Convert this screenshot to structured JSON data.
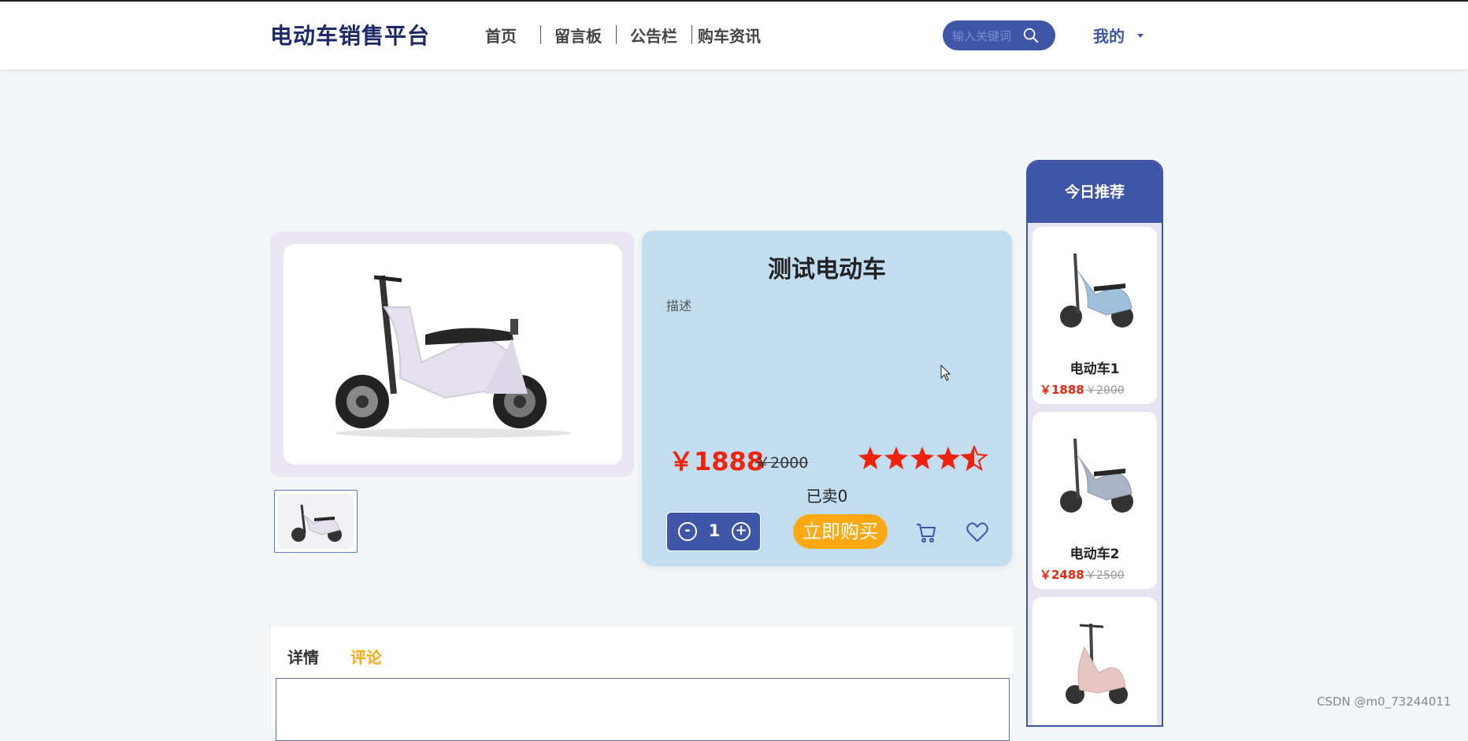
{
  "header": {
    "logo": "电动车销售平台",
    "nav": [
      "首页",
      "留言板",
      "公告栏",
      "购车资讯"
    ],
    "search_placeholder": "输入关键词",
    "user_menu": "我的"
  },
  "product": {
    "title": "测试电动车",
    "description": "描述",
    "price": "￥1888",
    "original_price": "￥2000",
    "rating": 4.5,
    "rating_max": 5,
    "sold": "已卖0",
    "quantity": "1",
    "decrement": "-",
    "increment": "+",
    "buy_label": "立即购买"
  },
  "recommend": {
    "title": "今日推荐",
    "items": [
      {
        "name": "电动车1",
        "price": "￥1888",
        "original": "￥2000",
        "color": "#9fbfda"
      },
      {
        "name": "电动车2",
        "price": "￥2488",
        "original": "￥2500",
        "color": "#a7b3c6"
      },
      {
        "name": "",
        "price": "",
        "original": "",
        "color": "#e7c6c2"
      }
    ]
  },
  "tabs": [
    "详情",
    "评论"
  ],
  "active_tab": 1,
  "colors": {
    "primary": "#3e55a8",
    "price_red": "#f0230a",
    "accent_orange": "#ffa811",
    "info_bg": "#c2ddef"
  },
  "watermark": "CSDN @m0_73244011"
}
